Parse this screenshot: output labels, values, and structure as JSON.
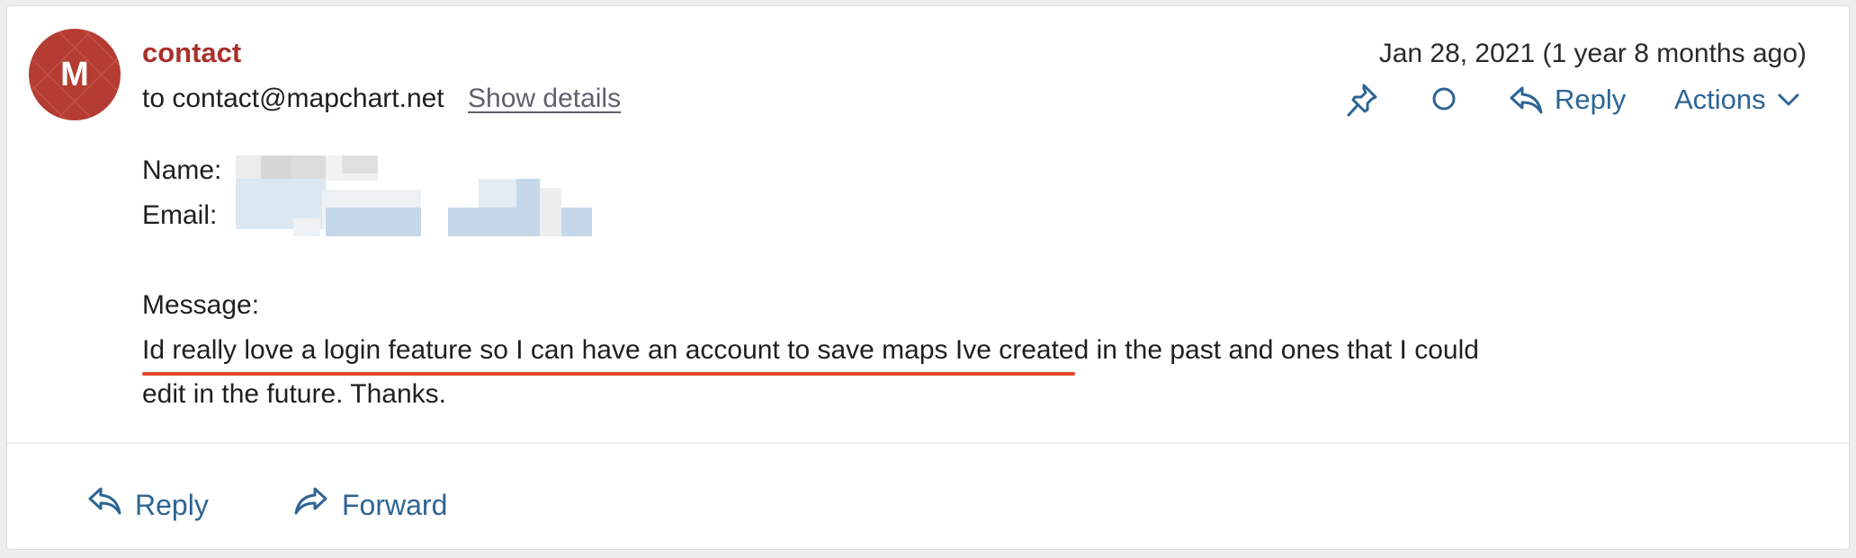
{
  "sender": {
    "avatar_letter": "M",
    "name": "contact",
    "recipient_prefix": "to",
    "recipient_address": "contact@mapchart.net",
    "show_details_label": "Show details"
  },
  "date": {
    "absolute": "Jan 28, 2021",
    "relative": "(1 year 8 months ago)"
  },
  "actions": {
    "pin_icon": "pin-icon",
    "mark_icon": "circle-icon",
    "reply_label": "Reply",
    "actions_label": "Actions"
  },
  "body": {
    "name_label": "Name:",
    "email_label": "Email:",
    "message_label": "Message:",
    "message_line1": "Id really love a login feature so I can have an account to save maps Ive created in the past and ones that I could",
    "message_line2": "edit in the future. Thanks."
  },
  "footer": {
    "reply_label": "Reply",
    "forward_label": "Forward"
  },
  "colors": {
    "sender": "#a8312a",
    "avatar": "#b43c32",
    "link_blue": "#2d6494",
    "annotation_underline": "#e2472b"
  }
}
